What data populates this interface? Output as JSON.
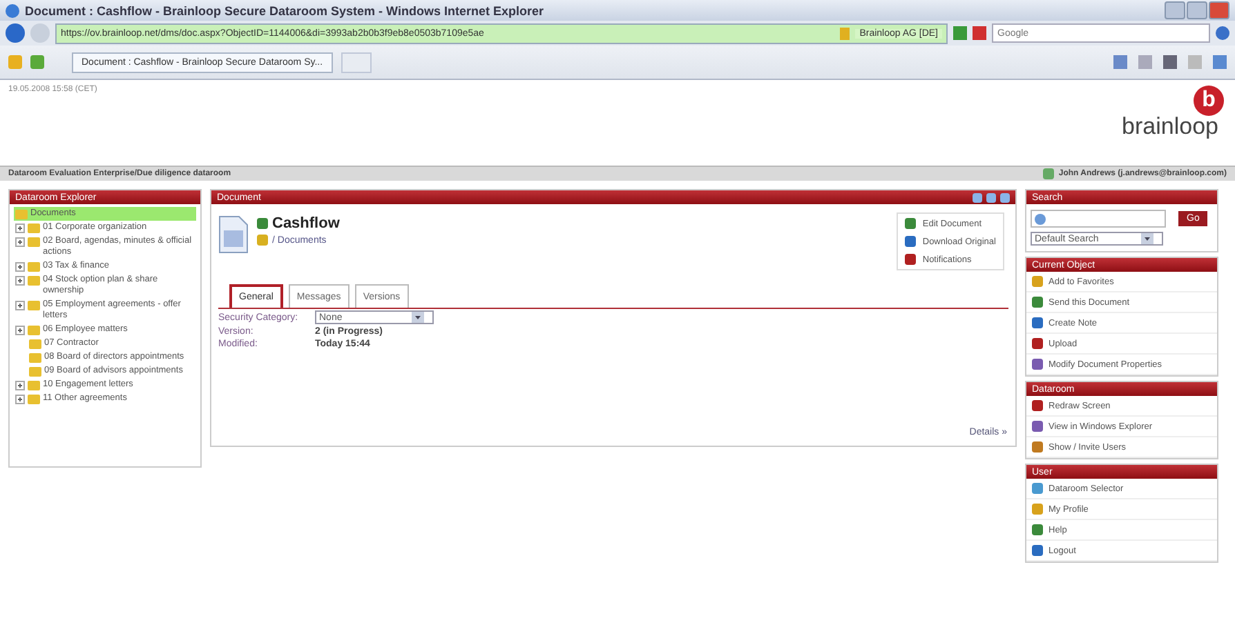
{
  "window": {
    "title": "Document : Cashflow - Brainloop Secure Dataroom System - Windows Internet Explorer"
  },
  "browser": {
    "url": "https://ov.brainloop.net/dms/doc.aspx?ObjectID=1144006&di=3993ab2b0b3f9eb8e0503b7109e5ae",
    "certificate": "Brainloop AG [DE]",
    "search_placeholder": "Google",
    "tab": "Document : Cashflow - Brainloop Secure Dataroom Sy..."
  },
  "page": {
    "timestamp": "19.05.2008 15:58 (CET)",
    "logo": "brainloop",
    "logo_mark": "b",
    "breadcrumb": "Dataroom Evaluation Enterprise/Due diligence dataroom",
    "user": "John Andrews (j.andrews@brainloop.com)"
  },
  "explorer": {
    "title": "Dataroom Explorer",
    "tree": [
      {
        "label": "Documents",
        "selected": true,
        "children": [
          {
            "label": "01 Corporate organization",
            "selected": false,
            "expanded": false
          },
          {
            "label": "02 Board, agendas, minutes & official actions",
            "selected": false,
            "expanded": false
          },
          {
            "label": "03 Tax & finance",
            "selected": false,
            "expanded": false
          },
          {
            "label": "04 Stock option plan & share ownership",
            "selected": false,
            "expanded": false
          },
          {
            "label": "05 Employment agreements - offer letters",
            "selected": false,
            "expanded": false
          },
          {
            "label": "06 Employee matters",
            "selected": false,
            "expanded": false
          },
          {
            "label": "07 Contractor",
            "selected": false
          },
          {
            "label": "08 Board of directors appointments",
            "selected": false
          },
          {
            "label": "09 Board of advisors appointments",
            "selected": false
          },
          {
            "label": "10 Engagement letters",
            "selected": false,
            "expanded": false
          },
          {
            "label": "11 Other agreements",
            "selected": false,
            "expanded": false
          }
        ]
      }
    ]
  },
  "document": {
    "title": "Document",
    "name": "Cashflow",
    "path": "/ Documents",
    "actions": [
      "Edit Document",
      "Download Original",
      "Notifications"
    ],
    "tabs": [
      {
        "label": "General",
        "selected": true
      },
      {
        "label": "Messages",
        "selected": false
      },
      {
        "label": "Versions",
        "selected": false
      }
    ],
    "fields": [
      {
        "kind": "select",
        "label": "Security Category:",
        "value": "None"
      },
      {
        "kind": "text",
        "label": "Version:",
        "value": "2 (in Progress)"
      },
      {
        "kind": "text",
        "label": "Modified:",
        "value": "Today 15:44"
      }
    ],
    "details_link": "Details »"
  },
  "sidebar": {
    "search": {
      "title": "Search",
      "button": "Go",
      "scope": "Default Search"
    },
    "sections": [
      {
        "title": "Current Object",
        "items": [
          "Add to Favorites",
          "Send this Document",
          "Create Note",
          "Upload",
          "Modify Document Properties"
        ]
      },
      {
        "title": "Dataroom",
        "items": [
          "Redraw Screen",
          "View in Windows Explorer",
          "Show / Invite Users"
        ]
      },
      {
        "title": "User",
        "items": [
          "Dataroom Selector",
          "My Profile",
          "Help",
          "Logout"
        ]
      }
    ]
  }
}
